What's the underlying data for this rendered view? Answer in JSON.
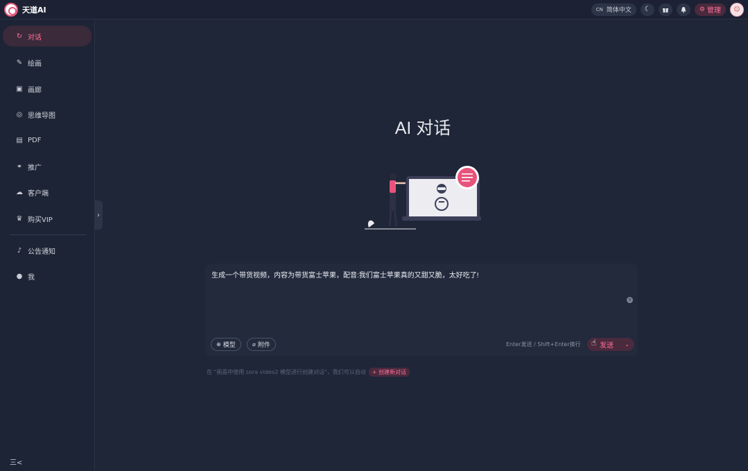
{
  "app": {
    "name": "天道AI"
  },
  "header": {
    "language_code": "CN",
    "language_label": "简体中文",
    "icons": [
      "moon-icon",
      "gift-icon",
      "bell-icon"
    ],
    "admin_label": "管理"
  },
  "sidebar": {
    "items": [
      {
        "label": "对话",
        "icon": "chat-icon",
        "active": true
      },
      {
        "label": "绘画",
        "icon": "brush-icon"
      },
      {
        "label": "画廊",
        "icon": "image-icon"
      },
      {
        "label": "思维导图",
        "icon": "mindmap-icon"
      },
      {
        "label": "PDF",
        "icon": "pdf-icon"
      },
      {
        "label": "推广",
        "icon": "handshake-icon"
      },
      {
        "label": "客户端",
        "icon": "cloud-icon"
      },
      {
        "label": "购买VIP",
        "icon": "crown-icon"
      }
    ],
    "bottom_items": [
      {
        "label": "公告通知",
        "icon": "bell-icon"
      },
      {
        "label": "我",
        "icon": "user-icon"
      }
    ],
    "collapse_label": "三<"
  },
  "main": {
    "title": "AI 对话",
    "input_text": "生成一个带货视频，内容为带货富士苹果，配音:我们富士苹果真的又甜又脆，太好吃了!",
    "model_chip": "模型",
    "attach_chip": "附件",
    "hint": "Enter发送 / Shift+Enter换行",
    "send_label": "发送",
    "footer_note": "在 \"画面中使用 sora video2 模型进行创建对话\"，我们可以自动",
    "footer_tag": "+ 创建新对话"
  },
  "colors": {
    "accent": "#ff6f97",
    "background": "#1f2638",
    "sidebar": "#1d2435"
  }
}
